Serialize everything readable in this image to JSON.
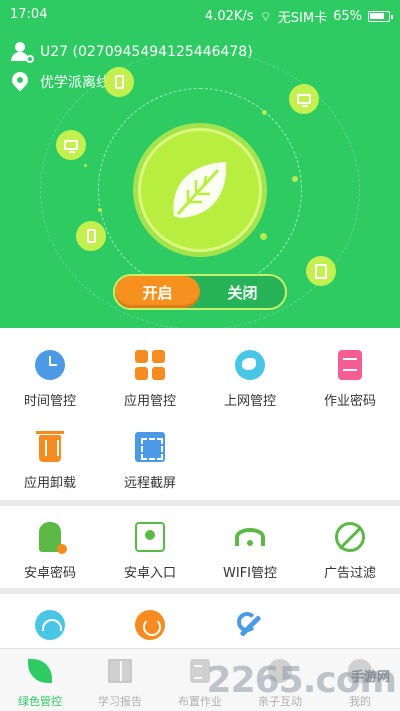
{
  "status_bar": {
    "time": "17:04",
    "speed": "4.02K/s",
    "sim": "无SIM卡",
    "battery": "65%"
  },
  "header": {
    "user": "U27 (0270945494125446478)",
    "location": "优学派离线"
  },
  "toggle": {
    "on_label": "开启",
    "off_label": "关闭",
    "state": "on"
  },
  "grid_main": [
    {
      "label": "时间管控",
      "icon": "clock-icon"
    },
    {
      "label": "应用管控",
      "icon": "apps-icon"
    },
    {
      "label": "上网管控",
      "icon": "globe-icon"
    },
    {
      "label": "作业密码",
      "icon": "homework-lock-icon"
    },
    {
      "label": "应用卸载",
      "icon": "trash-icon"
    },
    {
      "label": "远程截屏",
      "icon": "screenshot-icon"
    }
  ],
  "grid_second": [
    {
      "label": "安卓密码",
      "icon": "android-icon"
    },
    {
      "label": "安卓入口",
      "icon": "android-entry-icon"
    },
    {
      "label": "WIFI管控",
      "icon": "wifi-icon"
    },
    {
      "label": "广告过滤",
      "icon": "ad-filter-icon"
    }
  ],
  "grid_third": [
    {
      "icon": "wifi-round-icon"
    },
    {
      "icon": "power-icon"
    },
    {
      "icon": "wrench-icon"
    }
  ],
  "bottom_nav": [
    {
      "label": "绿色管控",
      "icon": "leaf-icon",
      "active": true
    },
    {
      "label": "学习报告",
      "icon": "book-icon",
      "active": false
    },
    {
      "label": "布置作业",
      "icon": "assignment-icon",
      "active": false
    },
    {
      "label": "亲子互动",
      "icon": "chat-icon",
      "active": false
    },
    {
      "label": "我的",
      "icon": "profile-icon",
      "active": false
    }
  ],
  "watermark": {
    "main": "2265.com",
    "sub": "手游网"
  },
  "colors": {
    "brand_green": "#2ecb63",
    "accent_orange": "#f6911d",
    "lime": "#b8ee3f"
  }
}
